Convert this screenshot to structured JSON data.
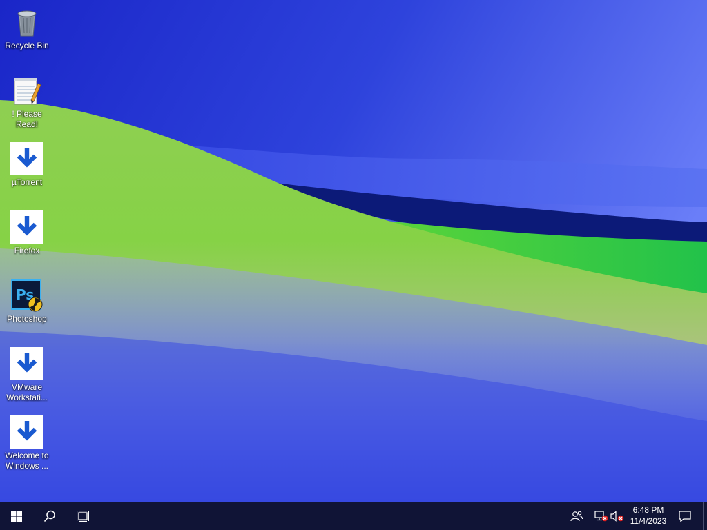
{
  "desktop": {
    "icons": [
      {
        "name": "recycle-bin",
        "label": "Recycle Bin",
        "icon": "recycle-bin-icon",
        "shortcut": false
      },
      {
        "name": "please-read",
        "label": "! Please Read!",
        "icon": "notepad-icon",
        "shortcut": false
      },
      {
        "name": "utorrent",
        "label": "µTorrent",
        "icon": "utorrent-icon",
        "shortcut": true
      },
      {
        "name": "firefox",
        "label": "Firefox",
        "icon": "firefox-icon",
        "shortcut": true
      },
      {
        "name": "photoshop",
        "label": "Photoshop",
        "icon": "photoshop-icon",
        "shortcut": false
      },
      {
        "name": "vmware-workstation",
        "label": "VMware\nWorkstati...",
        "icon": "vmware-icon",
        "shortcut": true
      },
      {
        "name": "welcome-to-windows",
        "label": "Welcome to\nWindows ...",
        "icon": "apple-icon",
        "shortcut": true
      }
    ]
  },
  "taskbar": {
    "start_icon": "windows-logo-icon",
    "search_icon": "search-icon",
    "taskview_icon": "task-view-icon",
    "tray": {
      "people_icon": "people-icon",
      "network_icon": "network-disconnected-icon",
      "volume_icon": "volume-muted-icon"
    },
    "clock": {
      "time": "6:48 PM",
      "date": "11/4/2023"
    },
    "notification_icon": "action-center-icon"
  },
  "colors": {
    "taskbar": "#101436",
    "wallpaper_blue": "#2f44e0",
    "wallpaper_green": "#7fd43f"
  }
}
